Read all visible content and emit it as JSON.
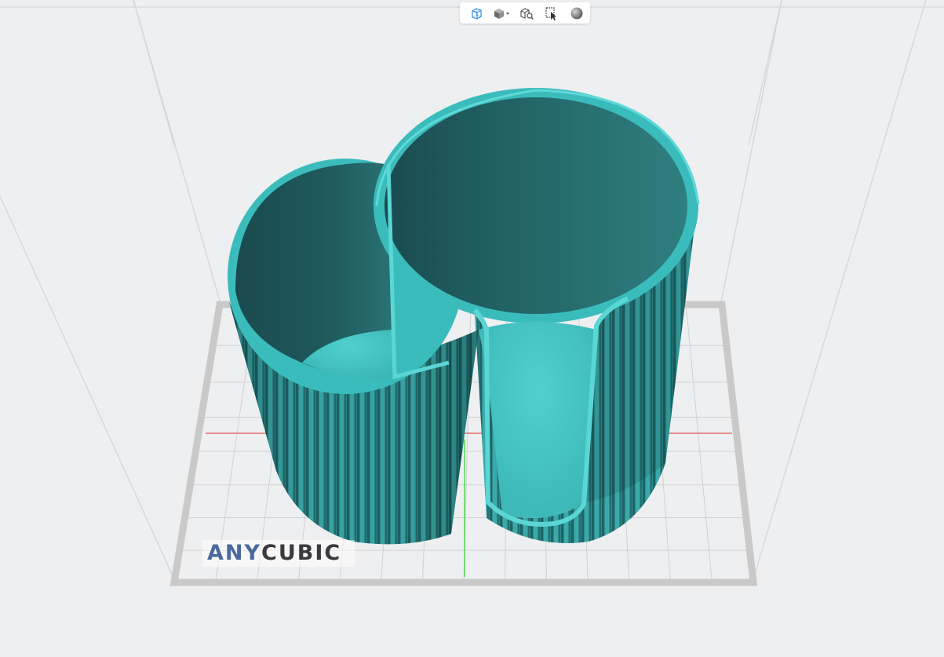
{
  "colors": {
    "background": "#eeeff1",
    "plate_border": "#c7c7c7",
    "grid_line": "#d2d3d5",
    "x_axis": "#e05050",
    "y_axis": "#3ad13a",
    "model_wall": "#2f8e8e",
    "model_rim": "#3bbcbc",
    "model_floor": "#43c2c1",
    "model_inner_dark": "#1b4d51",
    "logo_any": "#4a6a9c",
    "logo_cubic": "#3a3a3e",
    "toolbar_active": "#3a8ee6"
  },
  "toolbar": {
    "buttons": [
      {
        "icon": "wireframe-cube-icon",
        "active": true
      },
      {
        "icon": "solid-cube-dropdown-icon",
        "active": false
      },
      {
        "icon": "view-box-search-icon",
        "active": false
      },
      {
        "icon": "select-cursor-icon",
        "active": false
      },
      {
        "icon": "sphere-render-icon",
        "active": false
      }
    ]
  },
  "logo": {
    "part1": "ANY",
    "part2": "CUBIC"
  }
}
